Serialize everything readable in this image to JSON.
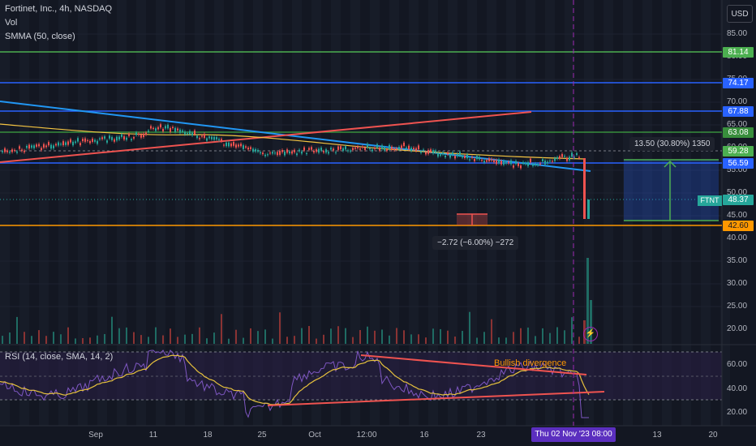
{
  "legend": {
    "title": "Fortinet, Inc., 4h, NASDAQ",
    "vol": "Vol",
    "smma": "SMMA (50, close)",
    "rsi": "RSI (14, close, SMA, 14, 2)"
  },
  "currency_button": "USD",
  "price_axis": {
    "labels": [
      "85.00",
      "80.00",
      "75.00",
      "70.00",
      "65.00",
      "60.00",
      "55.00",
      "50.00",
      "45.00",
      "40.00",
      "35.00",
      "30.00",
      "25.00",
      "20.00"
    ]
  },
  "price_tags": [
    {
      "value": "81.14",
      "bg": "#4caf50",
      "fg": "#ffffff"
    },
    {
      "value": "74.17",
      "bg": "#2962ff",
      "fg": "#ffffff"
    },
    {
      "value": "67.88",
      "bg": "#2962ff",
      "fg": "#ffffff"
    },
    {
      "value": "63.08",
      "bg": "#388e3c",
      "fg": "#ffffff"
    },
    {
      "value": "59.28",
      "bg": "#4caf50",
      "fg": "#ffffff"
    },
    {
      "value": "56.59",
      "bg": "#2962ff",
      "fg": "#ffffff"
    },
    {
      "value": "48.37",
      "bg": "#26a69a",
      "fg": "#ffffff"
    },
    {
      "value": "42.60",
      "bg": "#ff9800",
      "fg": "#131722"
    }
  ],
  "symbol_tag": "FTNT",
  "rsi_axis": {
    "labels": [
      "60.00",
      "40.00",
      "20.00"
    ]
  },
  "time_axis": {
    "labels": [
      "Sep",
      "11",
      "18",
      "25",
      "Oct",
      "12:00",
      "16",
      "23",
      "13",
      "20"
    ],
    "cursor": "Thu 02 Nov '23  08:00"
  },
  "measure_up": "13.50 (30.80%) 1350",
  "measure_down": "−2.72 (−6.00%) −272",
  "annotation": "Bullish divergence",
  "colors": {
    "background": "#131722",
    "up": "#26a69a",
    "down": "#ef5350",
    "blue": "#2962ff",
    "green": "#4caf50",
    "orange": "#ff9800",
    "smma": "#f5c542",
    "rsi": "#7e57c2"
  }
}
